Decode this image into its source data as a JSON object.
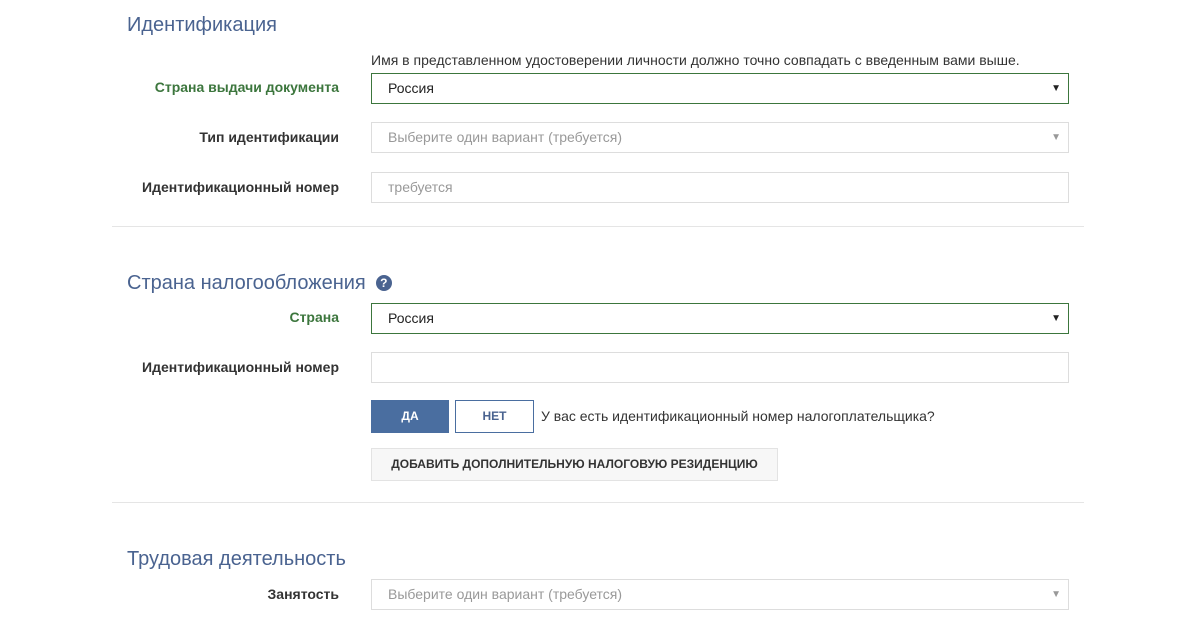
{
  "identification": {
    "title": "Идентификация",
    "hint": "Имя в представленном удостоверении личности должно точно совпадать с введенным вами выше.",
    "issuing_country": {
      "label": "Страна выдачи документа",
      "value": "Россия"
    },
    "id_type": {
      "label": "Тип идентификации",
      "placeholder": "Выберите один вариант (требуется)"
    },
    "id_number": {
      "label": "Идентификационный номер",
      "placeholder": "требуется"
    }
  },
  "tax_residency": {
    "title": "Страна налогообложения",
    "help_icon": "?",
    "country": {
      "label": "Страна",
      "value": "Россия"
    },
    "tax_id": {
      "label": "Идентификационный номер",
      "value": ""
    },
    "yes_label": "ДА",
    "no_label": "НЕТ",
    "question": "У вас есть идентификационный номер налогоплательщика?",
    "add_button_label": "ДОБАВИТЬ ДОПОЛНИТЕЛЬНУЮ НАЛОГОВУЮ РЕЗИДЕНЦИЮ"
  },
  "employment": {
    "title": "Трудовая деятельность",
    "status": {
      "label": "Занятость",
      "placeholder": "Выберите один вариант (требуется)"
    }
  },
  "icons": {
    "dropdown": "caret-down-icon",
    "help": "question-circle-icon"
  },
  "colors": {
    "section_title": "#4a6390",
    "valid_label": "#3c763d",
    "primary_button": "#4a6ea0"
  }
}
